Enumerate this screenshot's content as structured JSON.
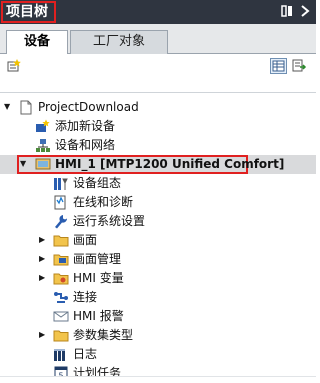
{
  "panel": {
    "title": "项目树",
    "pin_icon": "pin-icon",
    "menu_icon": "panel-menu-icon"
  },
  "tabs": [
    {
      "label": "设备",
      "active": true
    },
    {
      "label": "工厂对象",
      "active": false
    }
  ],
  "toolbar": {
    "icons": [
      "add-device-icon",
      "grid-view-icon",
      "export-icon"
    ]
  },
  "tree": {
    "items": [
      {
        "label": "ProjectDownload",
        "icon": "project-icon"
      },
      {
        "label": "添加新设备",
        "icon": "add-device-icon"
      },
      {
        "label": "设备和网络",
        "icon": "network-icon"
      },
      {
        "label": "HMI_1 [MTP1200 Unified Comfort]",
        "icon": "hmi-device-icon"
      },
      {
        "label": "设备组态",
        "icon": "device-config-icon"
      },
      {
        "label": "在线和诊断",
        "icon": "online-diagnostics-icon"
      },
      {
        "label": "运行系统设置",
        "icon": "runtime-settings-icon"
      },
      {
        "label": "画面",
        "icon": "folder-icon"
      },
      {
        "label": "画面管理",
        "icon": "folder-icon"
      },
      {
        "label": "HMI 变量",
        "icon": "folder-icon"
      },
      {
        "label": "连接",
        "icon": "connection-icon"
      },
      {
        "label": "HMI 报警",
        "icon": "alarm-icon"
      },
      {
        "label": "参数集类型",
        "icon": "folder-icon"
      },
      {
        "label": "日志",
        "icon": "log-icon"
      },
      {
        "label": "计划任务",
        "icon": "schedule-icon"
      }
    ]
  },
  "colors": {
    "titlebar": "#2f3540",
    "highlight": "#e02020",
    "selected_row": "#d9dadc"
  }
}
